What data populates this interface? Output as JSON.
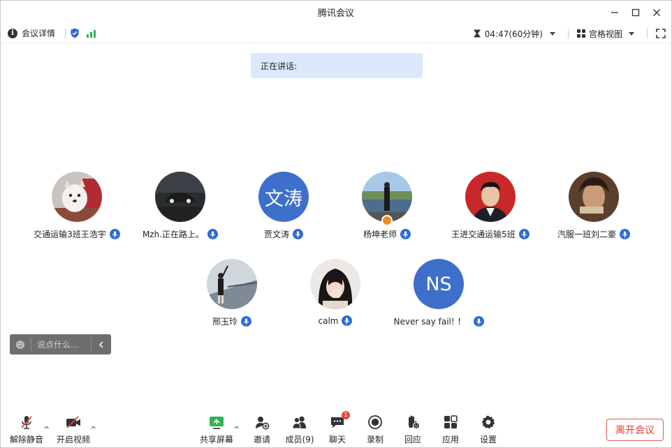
{
  "window": {
    "title": "腾讯会议"
  },
  "infobar": {
    "meeting_details": "会议详情",
    "timer": "04:47(60分钟)",
    "view_mode": "宫格视图"
  },
  "speaking": {
    "label": "正在讲话:"
  },
  "participants": [
    {
      "name": "交通运输3班王浩宇",
      "avatar_type": "photo-dog"
    },
    {
      "name": "Mzh.正在路上。",
      "avatar_type": "photo-car"
    },
    {
      "name": "贾文涛",
      "avatar_type": "text",
      "avatar_text": "文涛"
    },
    {
      "name": "杨坤老师",
      "avatar_type": "photo-lake",
      "host": true
    },
    {
      "name": "王进交通运输5班",
      "avatar_type": "photo-portrait"
    },
    {
      "name": "汽服一班刘二豪",
      "avatar_type": "photo-anime"
    },
    {
      "name": "邢玉玲",
      "avatar_type": "photo-bridge"
    },
    {
      "name": "calm",
      "avatar_type": "photo-girl"
    },
    {
      "name": "Never say fail! ！",
      "avatar_type": "text",
      "avatar_text": "NS"
    }
  ],
  "chat": {
    "placeholder": "说点什么..."
  },
  "toolbar": {
    "unmute": "解除静音",
    "start_video": "开启视频",
    "share_screen": "共享屏幕",
    "invite": "邀请",
    "members": "成员(9)",
    "chat": "聊天",
    "chat_badge": "1",
    "record": "录制",
    "react": "回应",
    "apps": "应用",
    "settings": "设置",
    "leave": "离开会议"
  },
  "colors": {
    "accent_blue": "#3e6fcb",
    "signal_green": "#2fb44f",
    "leave_red": "#e04136",
    "banner_blue": "#dbe9fb"
  }
}
